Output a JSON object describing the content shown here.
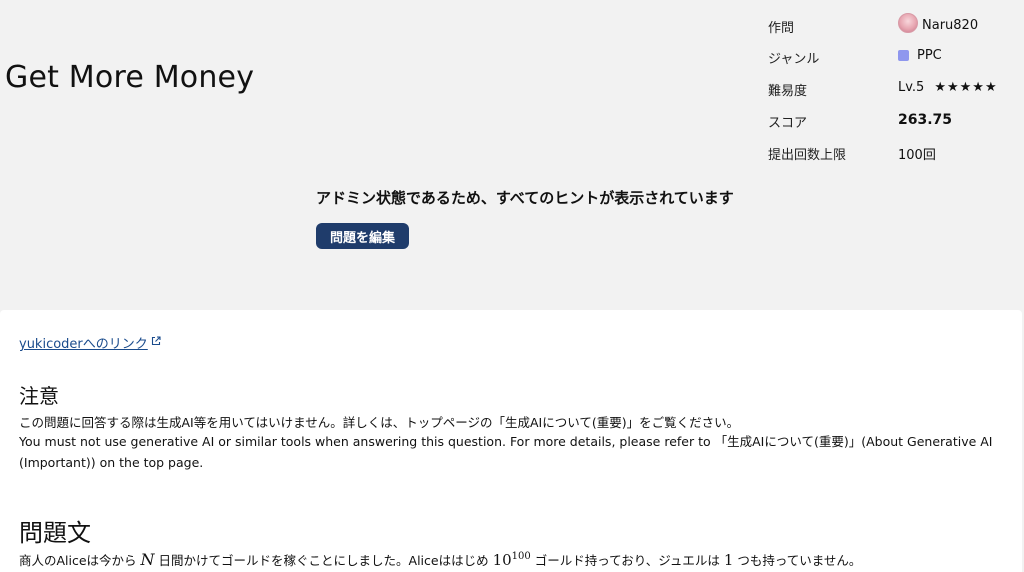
{
  "problem": {
    "title": "Get More Money"
  },
  "meta": {
    "author_label": "作問",
    "author": "Naru820",
    "genre_label": "ジャンル",
    "genre": "PPC",
    "genre_color": "#8f97ee",
    "difficulty_label": "難易度",
    "level": "Lv.5",
    "stars": "★★★★★",
    "score_label": "スコア",
    "score": "263.75",
    "limit_label": "提出回数上限",
    "limit": "100回"
  },
  "admin": {
    "notice": "アドミン状態であるため、すべてのヒントが表示されています",
    "edit_button": "問題を編集"
  },
  "content": {
    "yukicoder_link": "yukicoderへのリンク",
    "caution_heading": "注意",
    "caution_ja": "この問題に回答する際は生成AI等を用いてはいけません。詳しくは、トップページの「生成AIについて(重要)」をご覧ください。",
    "caution_en": "You must not use generative AI or similar tools when answering this question. For more details, please refer to 「生成AIについて(重要)」(About Generative AI (Important)) on the top page.",
    "statement_heading": "問題文",
    "statement_part1": "商人のAliceは今から ",
    "statement_var_n": "N",
    "statement_part2": " 日間かけてゴールドを稼ぐことにしました。Aliceははじめ ",
    "statement_base": "10",
    "statement_exp": "100",
    "statement_part3": " ゴールド持っており、ジュエルは ",
    "statement_one": "1",
    "statement_part4": " つも持っていません。"
  },
  "colors": {
    "accent": "#1f3c6b",
    "link": "#1a4b8c"
  }
}
